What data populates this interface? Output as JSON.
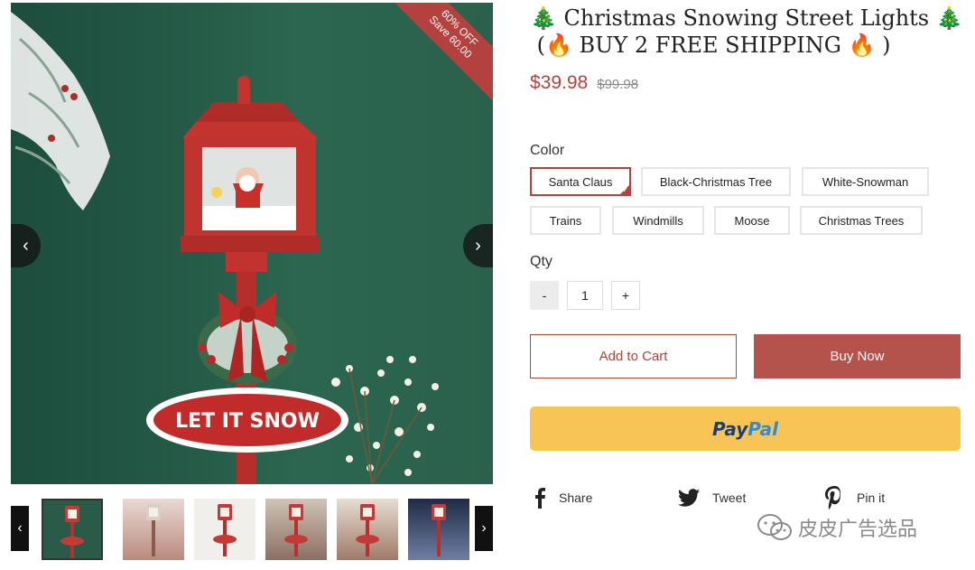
{
  "product": {
    "title_line1": "Christmas Snowing Street Lights",
    "title_line2": "BUY 2 FREE SHIPPING",
    "emoji_tree": "🎄",
    "emoji_fire": "🔥",
    "price": "$39.98",
    "compare_price": "$99.98"
  },
  "gallery": {
    "badge_line1": "60% OFF",
    "badge_line2": "Save 60.00",
    "sign_text": "LET IT SNOW",
    "thumbnail_count": 6,
    "active_thumbnail": 1
  },
  "options": {
    "color_label": "Color",
    "colors": [
      "Santa Claus",
      "Black-Christmas Tree",
      "White-Snowman",
      "Trains",
      "Windmills",
      "Moose",
      "Christmas Trees"
    ],
    "selected_color": "Santa Claus",
    "qty_label": "Qty",
    "qty_minus": "-",
    "qty_value": "1",
    "qty_plus": "+"
  },
  "actions": {
    "add_to_cart": "Add to Cart",
    "buy_now": "Buy Now",
    "paypal_pay": "Pay",
    "paypal_pal": "Pal"
  },
  "share": {
    "facebook": "Share",
    "twitter": "Tweet",
    "pinterest": "Pin it"
  },
  "watermark": {
    "text": "皮皮广告选品",
    "icon": "wechat-icon"
  },
  "colors": {
    "accent": "#b3423f",
    "buy_now_bg": "#b4524c",
    "paypal_bg": "#f8c456",
    "paypal_dark": "#1a3d7c",
    "paypal_light": "#2a8fd6",
    "background_green": "#245a47"
  },
  "icons": {
    "gallery_prev": "chevron-left-icon",
    "gallery_next": "chevron-right-icon",
    "facebook": "facebook-icon",
    "twitter": "twitter-icon",
    "pinterest": "pinterest-icon"
  }
}
